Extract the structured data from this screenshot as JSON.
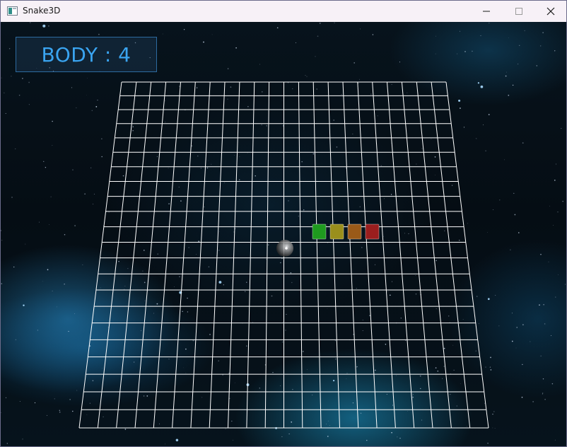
{
  "window": {
    "title": "Snake3D",
    "minimize_icon": "minimize-icon",
    "maximize_icon": "maximize-icon",
    "close_icon": "close-icon"
  },
  "hud": {
    "body_label": "BODY : 4"
  },
  "game": {
    "grid_color": "#ffffff",
    "snake_colors": [
      "#1f9a1f",
      "#9a8f1c",
      "#9a5a18",
      "#9a1e1e"
    ],
    "food_color": "#b8b8b8"
  }
}
